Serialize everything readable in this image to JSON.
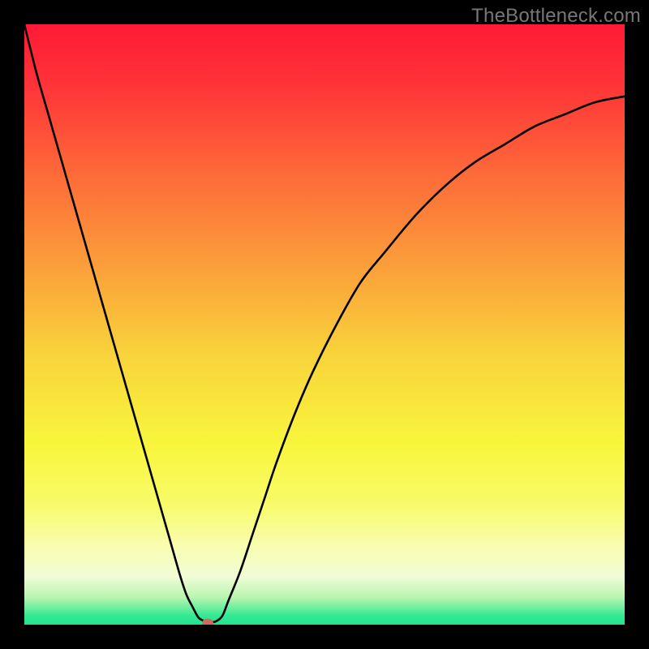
{
  "watermark": "TheBottleneck.com",
  "chart_data": {
    "type": "line",
    "title": "",
    "xlabel": "",
    "ylabel": "",
    "xlim": [
      0,
      100
    ],
    "ylim": [
      0,
      100
    ],
    "grid": false,
    "legend": false,
    "gradient_stops": [
      {
        "pos": 0.0,
        "color": "#FF1A36"
      },
      {
        "pos": 0.1,
        "color": "#FF3338"
      },
      {
        "pos": 0.25,
        "color": "#FD6A39"
      },
      {
        "pos": 0.4,
        "color": "#FB9E3A"
      },
      {
        "pos": 0.55,
        "color": "#F9D33B"
      },
      {
        "pos": 0.7,
        "color": "#F8F63C"
      },
      {
        "pos": 0.8,
        "color": "#F8FB6A"
      },
      {
        "pos": 0.87,
        "color": "#F9FDB0"
      },
      {
        "pos": 0.92,
        "color": "#F1FCD7"
      },
      {
        "pos": 0.955,
        "color": "#B7F5AF"
      },
      {
        "pos": 0.985,
        "color": "#34E994"
      },
      {
        "pos": 1.0,
        "color": "#22E28F"
      }
    ],
    "series": [
      {
        "name": "bottleneck-curve",
        "color": "#000000",
        "width": 2.6,
        "x": [
          0,
          2,
          4,
          6,
          8,
          10,
          12,
          14,
          16,
          18,
          20,
          22,
          24,
          26,
          27,
          28,
          29,
          30,
          31,
          32,
          33,
          34,
          36,
          38,
          40,
          42,
          45,
          48,
          52,
          56,
          60,
          65,
          70,
          75,
          80,
          85,
          90,
          95,
          100
        ],
        "values": [
          100,
          92,
          85,
          78,
          71,
          64,
          57,
          50,
          43,
          36,
          29,
          22,
          15,
          8,
          5,
          3,
          1.2,
          0.6,
          0.4,
          0.6,
          1.5,
          4,
          9,
          15,
          21,
          27,
          35,
          42,
          50,
          57,
          62,
          68,
          73,
          77,
          80,
          83,
          85,
          87,
          88
        ]
      }
    ],
    "marker": {
      "x": 30.5,
      "y": 0.3,
      "color": "#CE6B5D"
    }
  }
}
